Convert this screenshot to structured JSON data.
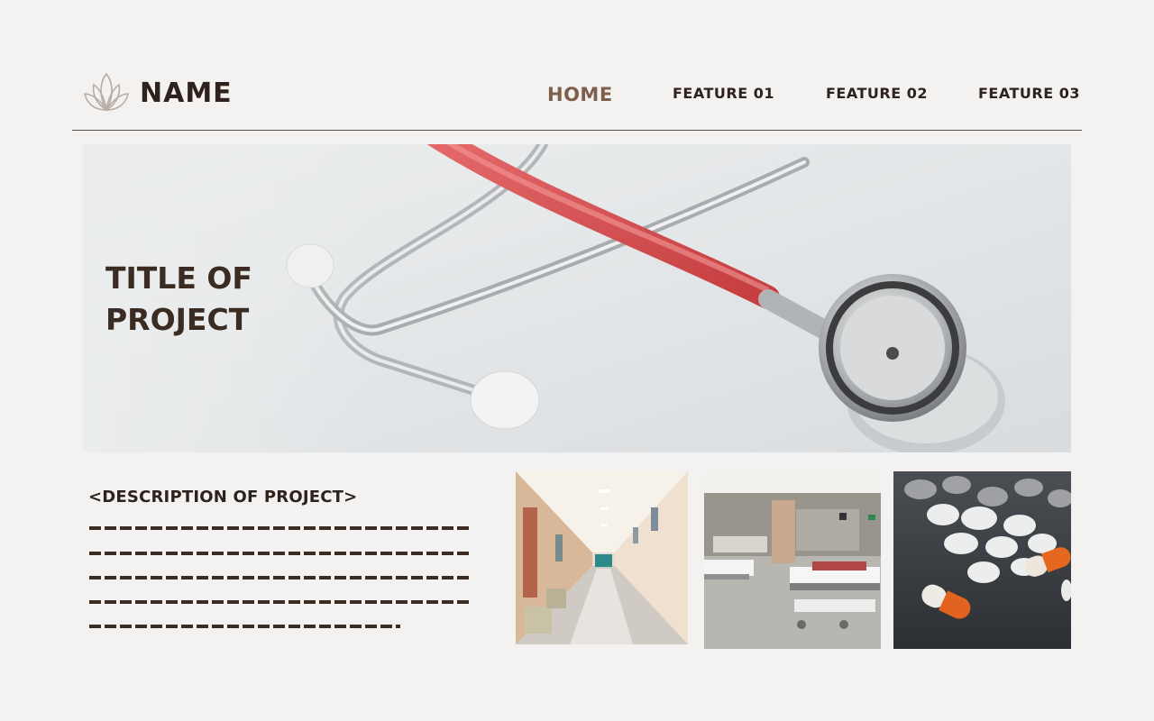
{
  "header": {
    "brand": "NAME",
    "logo_icon": "lotus-icon",
    "nav": [
      "HOME",
      "FEATURE 01",
      "FEATURE 02",
      "FEATURE 03"
    ],
    "active_nav": "HOME"
  },
  "hero": {
    "title_line1": "TITLE OF",
    "title_line2": "PROJECT"
  },
  "description": {
    "title": "<DESCRIPTION OF PROJECT>"
  },
  "colors": {
    "background": "#f4f2f0",
    "text": "#2e221c",
    "accent": "#7e5f4c"
  }
}
